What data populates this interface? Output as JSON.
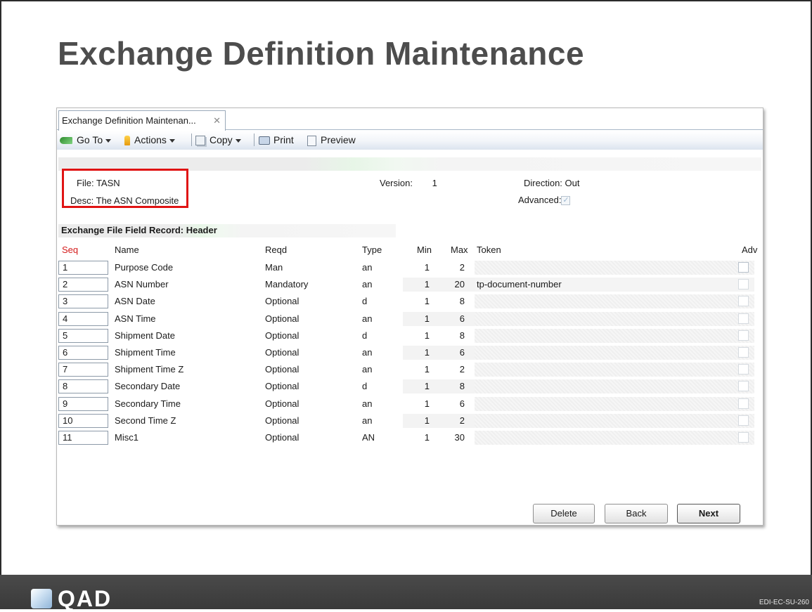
{
  "slide": {
    "title": "Exchange Definition Maintenance",
    "logo_text": "QAD",
    "code": "EDI-EC-SU-260"
  },
  "tab": {
    "label": "Exchange Definition Maintenan...",
    "close": "✕"
  },
  "toolbar": {
    "goto": "Go To",
    "actions": "Actions",
    "copy": "Copy",
    "print": "Print",
    "preview": "Preview"
  },
  "header": {
    "file_label": "File:",
    "file_value": "TASN",
    "desc_label": "Desc:",
    "desc_value": "The ASN Composite",
    "version_label": "Version:",
    "version_value": "1",
    "direction_label": "Direction:",
    "direction_value": "Out",
    "advanced_label": "Advanced:",
    "advanced_checked": true
  },
  "section": {
    "title": "Exchange File Field Record: Header"
  },
  "columns": {
    "seq": "Seq",
    "name": "Name",
    "reqd": "Reqd",
    "type": "Type",
    "min": "Min",
    "max": "Max",
    "token": "Token",
    "adv": "Adv"
  },
  "rows": [
    {
      "seq": "1",
      "name": "Purpose Code",
      "reqd": "Man",
      "type": "an",
      "min": "1",
      "max": "2",
      "token": ""
    },
    {
      "seq": "2",
      "name": "ASN Number",
      "reqd": "Mandatory",
      "type": "an",
      "min": "1",
      "max": "20",
      "token": "tp-document-number"
    },
    {
      "seq": "3",
      "name": "ASN Date",
      "reqd": "Optional",
      "type": "d",
      "min": "1",
      "max": "8",
      "token": ""
    },
    {
      "seq": "4",
      "name": "ASN Time",
      "reqd": "Optional",
      "type": "an",
      "min": "1",
      "max": "6",
      "token": ""
    },
    {
      "seq": "5",
      "name": "Shipment Date",
      "reqd": "Optional",
      "type": "d",
      "min": "1",
      "max": "8",
      "token": ""
    },
    {
      "seq": "6",
      "name": "Shipment Time",
      "reqd": "Optional",
      "type": "an",
      "min": "1",
      "max": "6",
      "token": ""
    },
    {
      "seq": "7",
      "name": "Shipment Time Z",
      "reqd": "Optional",
      "type": "an",
      "min": "1",
      "max": "2",
      "token": ""
    },
    {
      "seq": "8",
      "name": "Secondary Date",
      "reqd": "Optional",
      "type": "d",
      "min": "1",
      "max": "8",
      "token": ""
    },
    {
      "seq": "9",
      "name": "Secondary Time",
      "reqd": "Optional",
      "type": "an",
      "min": "1",
      "max": "6",
      "token": ""
    },
    {
      "seq": "10",
      "name": "Second Time Z",
      "reqd": "Optional",
      "type": "an",
      "min": "1",
      "max": "2",
      "token": ""
    },
    {
      "seq": "11",
      "name": "Misc1",
      "reqd": "Optional",
      "type": "AN",
      "min": "1",
      "max": "30",
      "token": ""
    }
  ],
  "buttons": {
    "delete": "Delete",
    "back": "Back",
    "next": "Next"
  },
  "colors": {
    "highlight_box": "#e01414",
    "seq_header": "#d41c1c",
    "title": "#4d4d4d"
  }
}
